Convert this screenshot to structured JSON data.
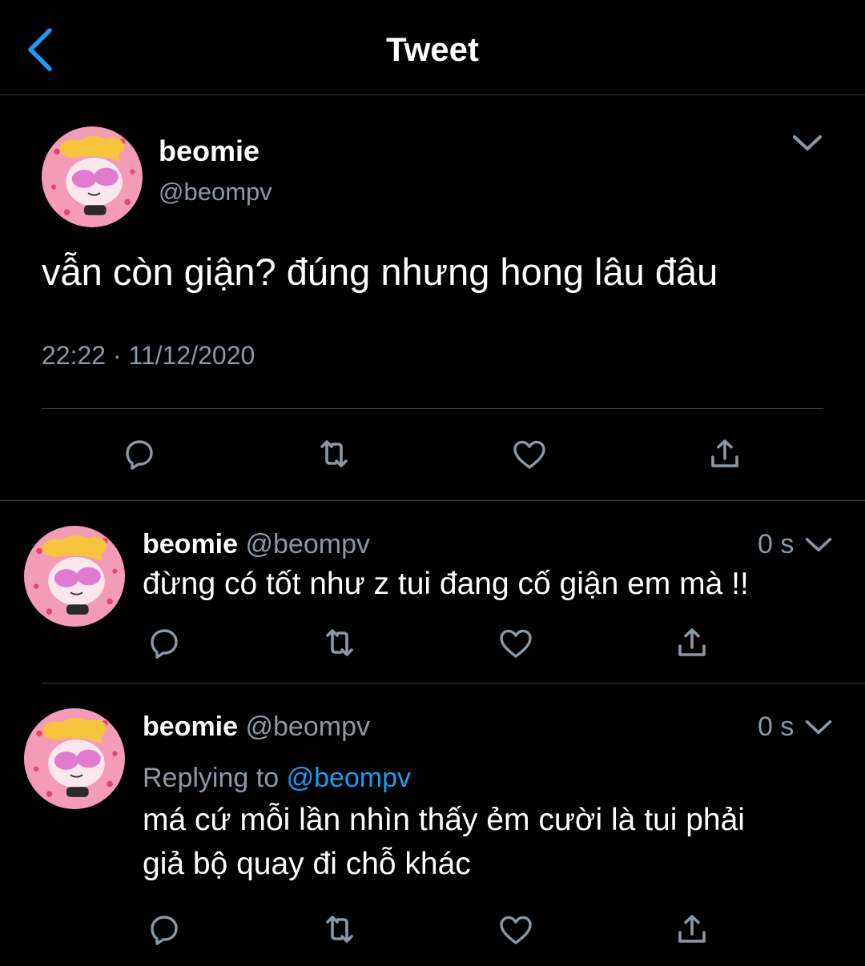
{
  "header": {
    "title": "Tweet"
  },
  "colors": {
    "accent": "#1d9bf0",
    "muted": "#8b98a5",
    "background": "#000000"
  },
  "main_tweet": {
    "display_name": "beomie",
    "handle": "@beompv",
    "text": "vẫn còn giận? đúng nhưng hong lâu đâu",
    "timestamp": "22:22 · 11/12/2020"
  },
  "replies": [
    {
      "display_name": "beomie",
      "handle": "@beompv",
      "time": "0 s",
      "text": "đừng có tốt như z tui đang cố giận em mà !!"
    },
    {
      "display_name": "beomie",
      "handle": "@beompv",
      "time": "0 s",
      "replying_to_prefix": "Replying to",
      "replying_to_handle": "@beompv",
      "text_line1": "má cứ mỗi lần nhìn thấy ẻm cười là tui phải",
      "text_line2": "giả bộ quay đi chỗ khác"
    }
  ],
  "icons": {
    "back": "chevron-left-icon",
    "more": "chevron-down-icon",
    "reply": "comment-icon",
    "retweet": "retweet-icon",
    "like": "heart-icon",
    "share": "share-icon",
    "avatar": "cartoon-avatar"
  }
}
